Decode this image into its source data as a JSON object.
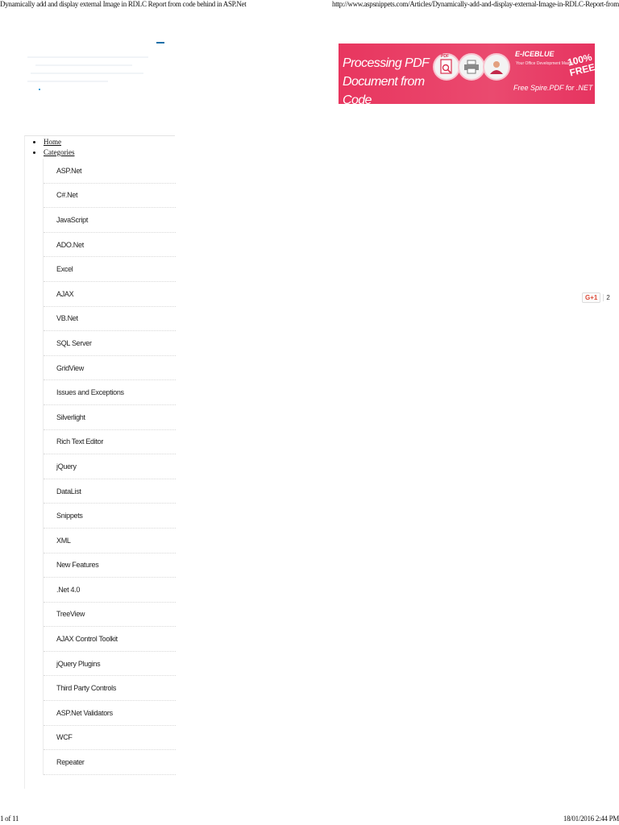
{
  "print_header": {
    "title": "Dynamically add and display external Image in RDLC Report from code behind in ASP.Net",
    "url": "http://www.aspsnippets.com/Articles/Dynamically-add-and-display-external-Image-in-RDLC-Report-from-code-behind-in-ASP.Net.aspx"
  },
  "ad": {
    "headline_line1": "Processing PDF",
    "headline_line2": "Document from Code",
    "pdf_badge": "PDF",
    "brand": "E-ICEBLUE",
    "brand_tagline": "Your Office Development Master",
    "product": "Free Spire.PDF for .NET",
    "free_line1": "100%",
    "free_line2": "FREE",
    "colors": {
      "background": "#e8365f",
      "text": "#ffffff"
    }
  },
  "social": {
    "gplus_label": "G+1",
    "gplus_count": "2",
    "icon": "google-plus-icon"
  },
  "nav": {
    "home": "Home",
    "categories_label": "Categories",
    "categories": [
      "ASP.Net",
      "C#.Net",
      "JavaScript",
      "ADO.Net",
      "Excel",
      "AJAX",
      "VB.Net",
      "SQL Server",
      "GridView",
      "Issues and Exceptions",
      "Silverlight",
      "Rich Text Editor",
      "jQuery",
      "DataList",
      "Snippets",
      "XML",
      "New Features",
      ".Net 4.0",
      "TreeView",
      "AJAX Control Toolkit",
      "jQuery Plugins",
      "Third Party Controls",
      "ASP.Net Validators",
      "WCF",
      "Repeater"
    ]
  },
  "print_footer": {
    "page": "1 of 11",
    "date": "18/01/2016 2:44 PM"
  }
}
